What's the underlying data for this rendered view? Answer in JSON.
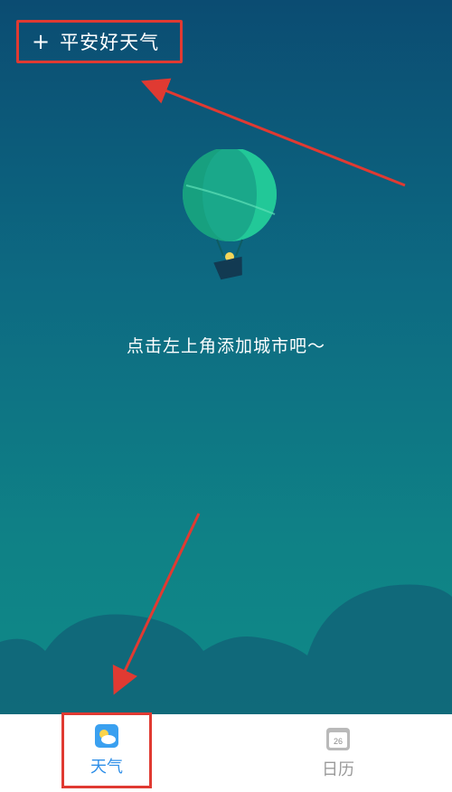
{
  "header": {
    "add_city_icon": "plus-icon",
    "add_city_label": "平安好天气"
  },
  "main": {
    "illustration": "hot-air-balloon",
    "empty_hint": "点击左上角添加城市吧～"
  },
  "tabbar": {
    "tabs": [
      {
        "label": "天气",
        "icon": "weather-icon",
        "active": true
      },
      {
        "label": "日历",
        "icon": "calendar-icon",
        "active": false,
        "icon_text": "26"
      }
    ]
  },
  "colors": {
    "sky_top": "#0b4c72",
    "sky_bottom": "#0f8a88",
    "hills": "#116478",
    "highlight_box": "#e03a32",
    "active_tab": "#2f8fe8",
    "inactive_tab": "#9a9a9a"
  }
}
